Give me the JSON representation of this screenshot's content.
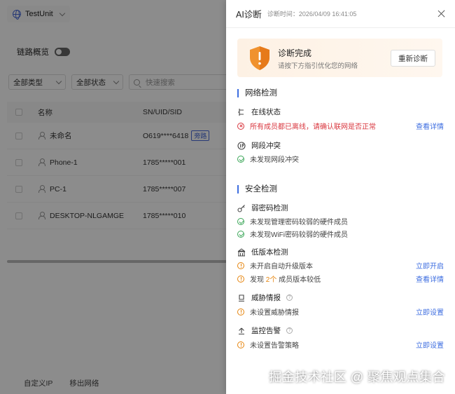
{
  "bg": {
    "unit_name": "TestUnit",
    "link_overview": "链路概览",
    "filters": {
      "type": "全部类型",
      "status": "全部状态",
      "search_placeholder": "快速搜索"
    },
    "table": {
      "headers": {
        "name": "名称",
        "sn": "SN/UID/SID"
      },
      "rows": [
        {
          "name": "未命名",
          "sn": "O619****6418",
          "tag": "旁路"
        },
        {
          "name": "Phone-1",
          "sn": "1785*****001",
          "tag": ""
        },
        {
          "name": "PC-1",
          "sn": "1785*****007",
          "tag": ""
        },
        {
          "name": "DESKTOP-NLGAMGE",
          "sn": "1785*****010",
          "tag": ""
        }
      ]
    },
    "bottom": {
      "custom_ip": "自定义IP",
      "move_out": "移出网络"
    }
  },
  "drawer": {
    "title": "AI诊断",
    "time": "诊断时间：2026/04/09 16:41:05",
    "hero": {
      "title": "诊断完成",
      "subtitle": "请按下方指引优化您的网络",
      "button": "重新诊断"
    },
    "network": {
      "title": "网络检测",
      "online": {
        "title": "在线状态",
        "line": "所有成员都已离线，请确认联网是否正常",
        "action": "查看详情"
      },
      "conflict": {
        "title": "网段冲突",
        "line": "未发现网段冲突"
      }
    },
    "security": {
      "title": "安全检测",
      "weak": {
        "title": "弱密码检测",
        "line1": "未发现管理密码较弱的硬件成员",
        "line2": "未发现WiFi密码较弱的硬件成员"
      },
      "lowver": {
        "title": "低版本检测",
        "line1": "未开启自动升级版本",
        "action1": "立即开启",
        "line2_prefix": "发现",
        "line2_count": "2个",
        "line2_suffix": "成员版本较低",
        "action2": "查看详情"
      },
      "threat": {
        "title": "威胁情报",
        "line": "未设置威胁情报",
        "action": "立即设置"
      },
      "alert": {
        "title": "监控告警",
        "line": "未设置告警策略",
        "action": "立即设置"
      }
    }
  },
  "watermark": "掘金技术社区 @ 聚焦观点集合",
  "colors": {
    "accent": "#3e6ee0",
    "error": "#d9363e",
    "warning": "#e6850e",
    "success": "#3aa657"
  }
}
